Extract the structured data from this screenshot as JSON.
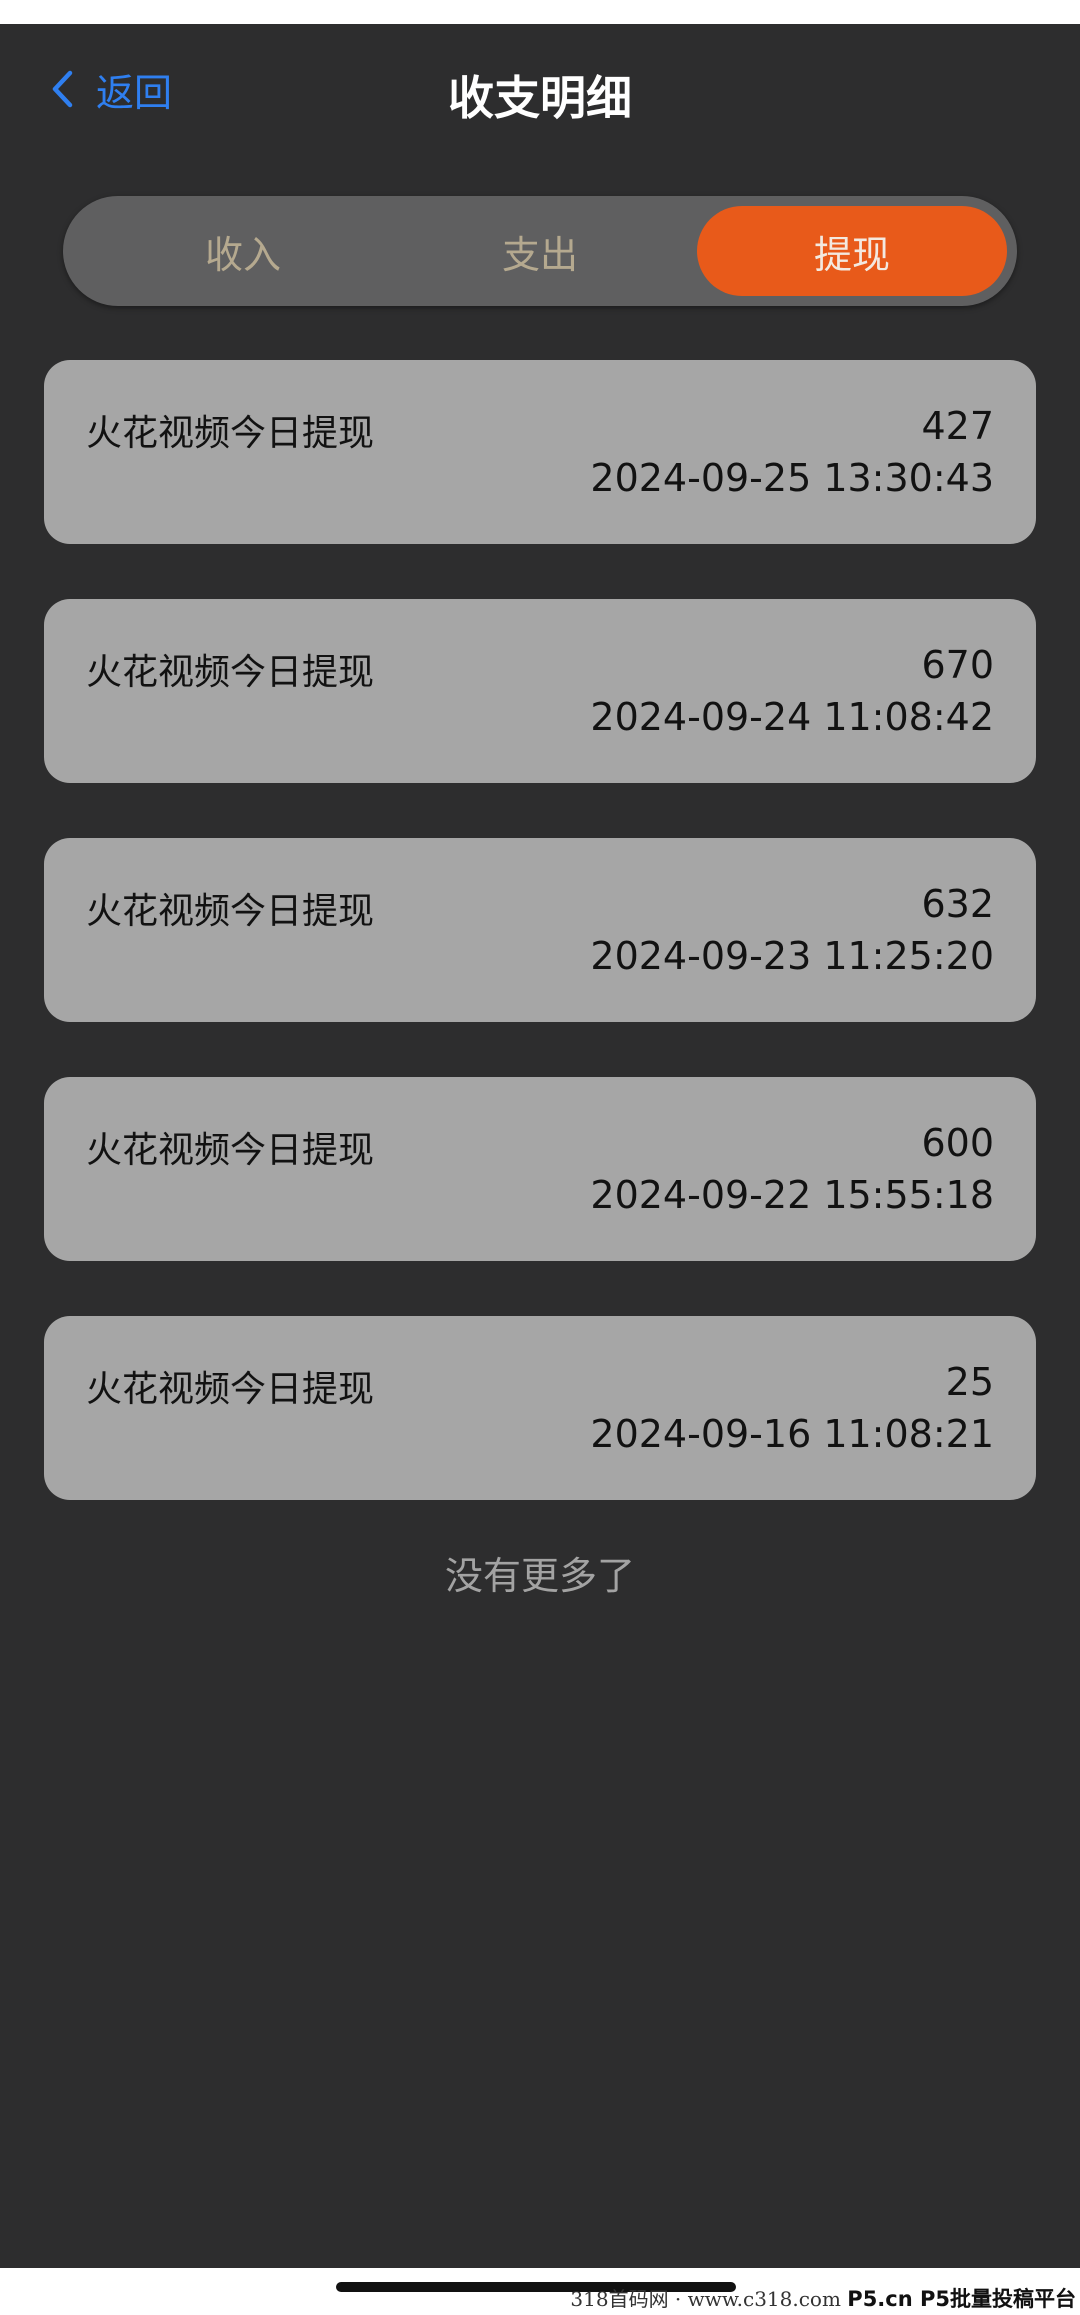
{
  "header": {
    "back_label": "返回",
    "title": "收支明细"
  },
  "tabs": [
    {
      "label": "收入",
      "active": false
    },
    {
      "label": "支出",
      "active": false
    },
    {
      "label": "提现",
      "active": true
    }
  ],
  "records": [
    {
      "title": "火花视频今日提现",
      "amount": "427",
      "time": "2024-09-25 13:30:43"
    },
    {
      "title": "火花视频今日提现",
      "amount": "670",
      "time": "2024-09-24 11:08:42"
    },
    {
      "title": "火花视频今日提现",
      "amount": "632",
      "time": "2024-09-23 11:25:20"
    },
    {
      "title": "火花视频今日提现",
      "amount": "600",
      "time": "2024-09-22 15:55:18"
    },
    {
      "title": "火花视频今日提现",
      "amount": "25",
      "time": "2024-09-16 11:08:21"
    }
  ],
  "footer": {
    "no_more": "没有更多了"
  },
  "watermark": {
    "left": "318首码网 · www.c318.com",
    "right": "P5.cn P5批量投稿平台"
  },
  "colors": {
    "background": "#2d2d2e",
    "accent": "#e85a1a",
    "link": "#2f7ff0",
    "card": "#a6a6a6"
  }
}
